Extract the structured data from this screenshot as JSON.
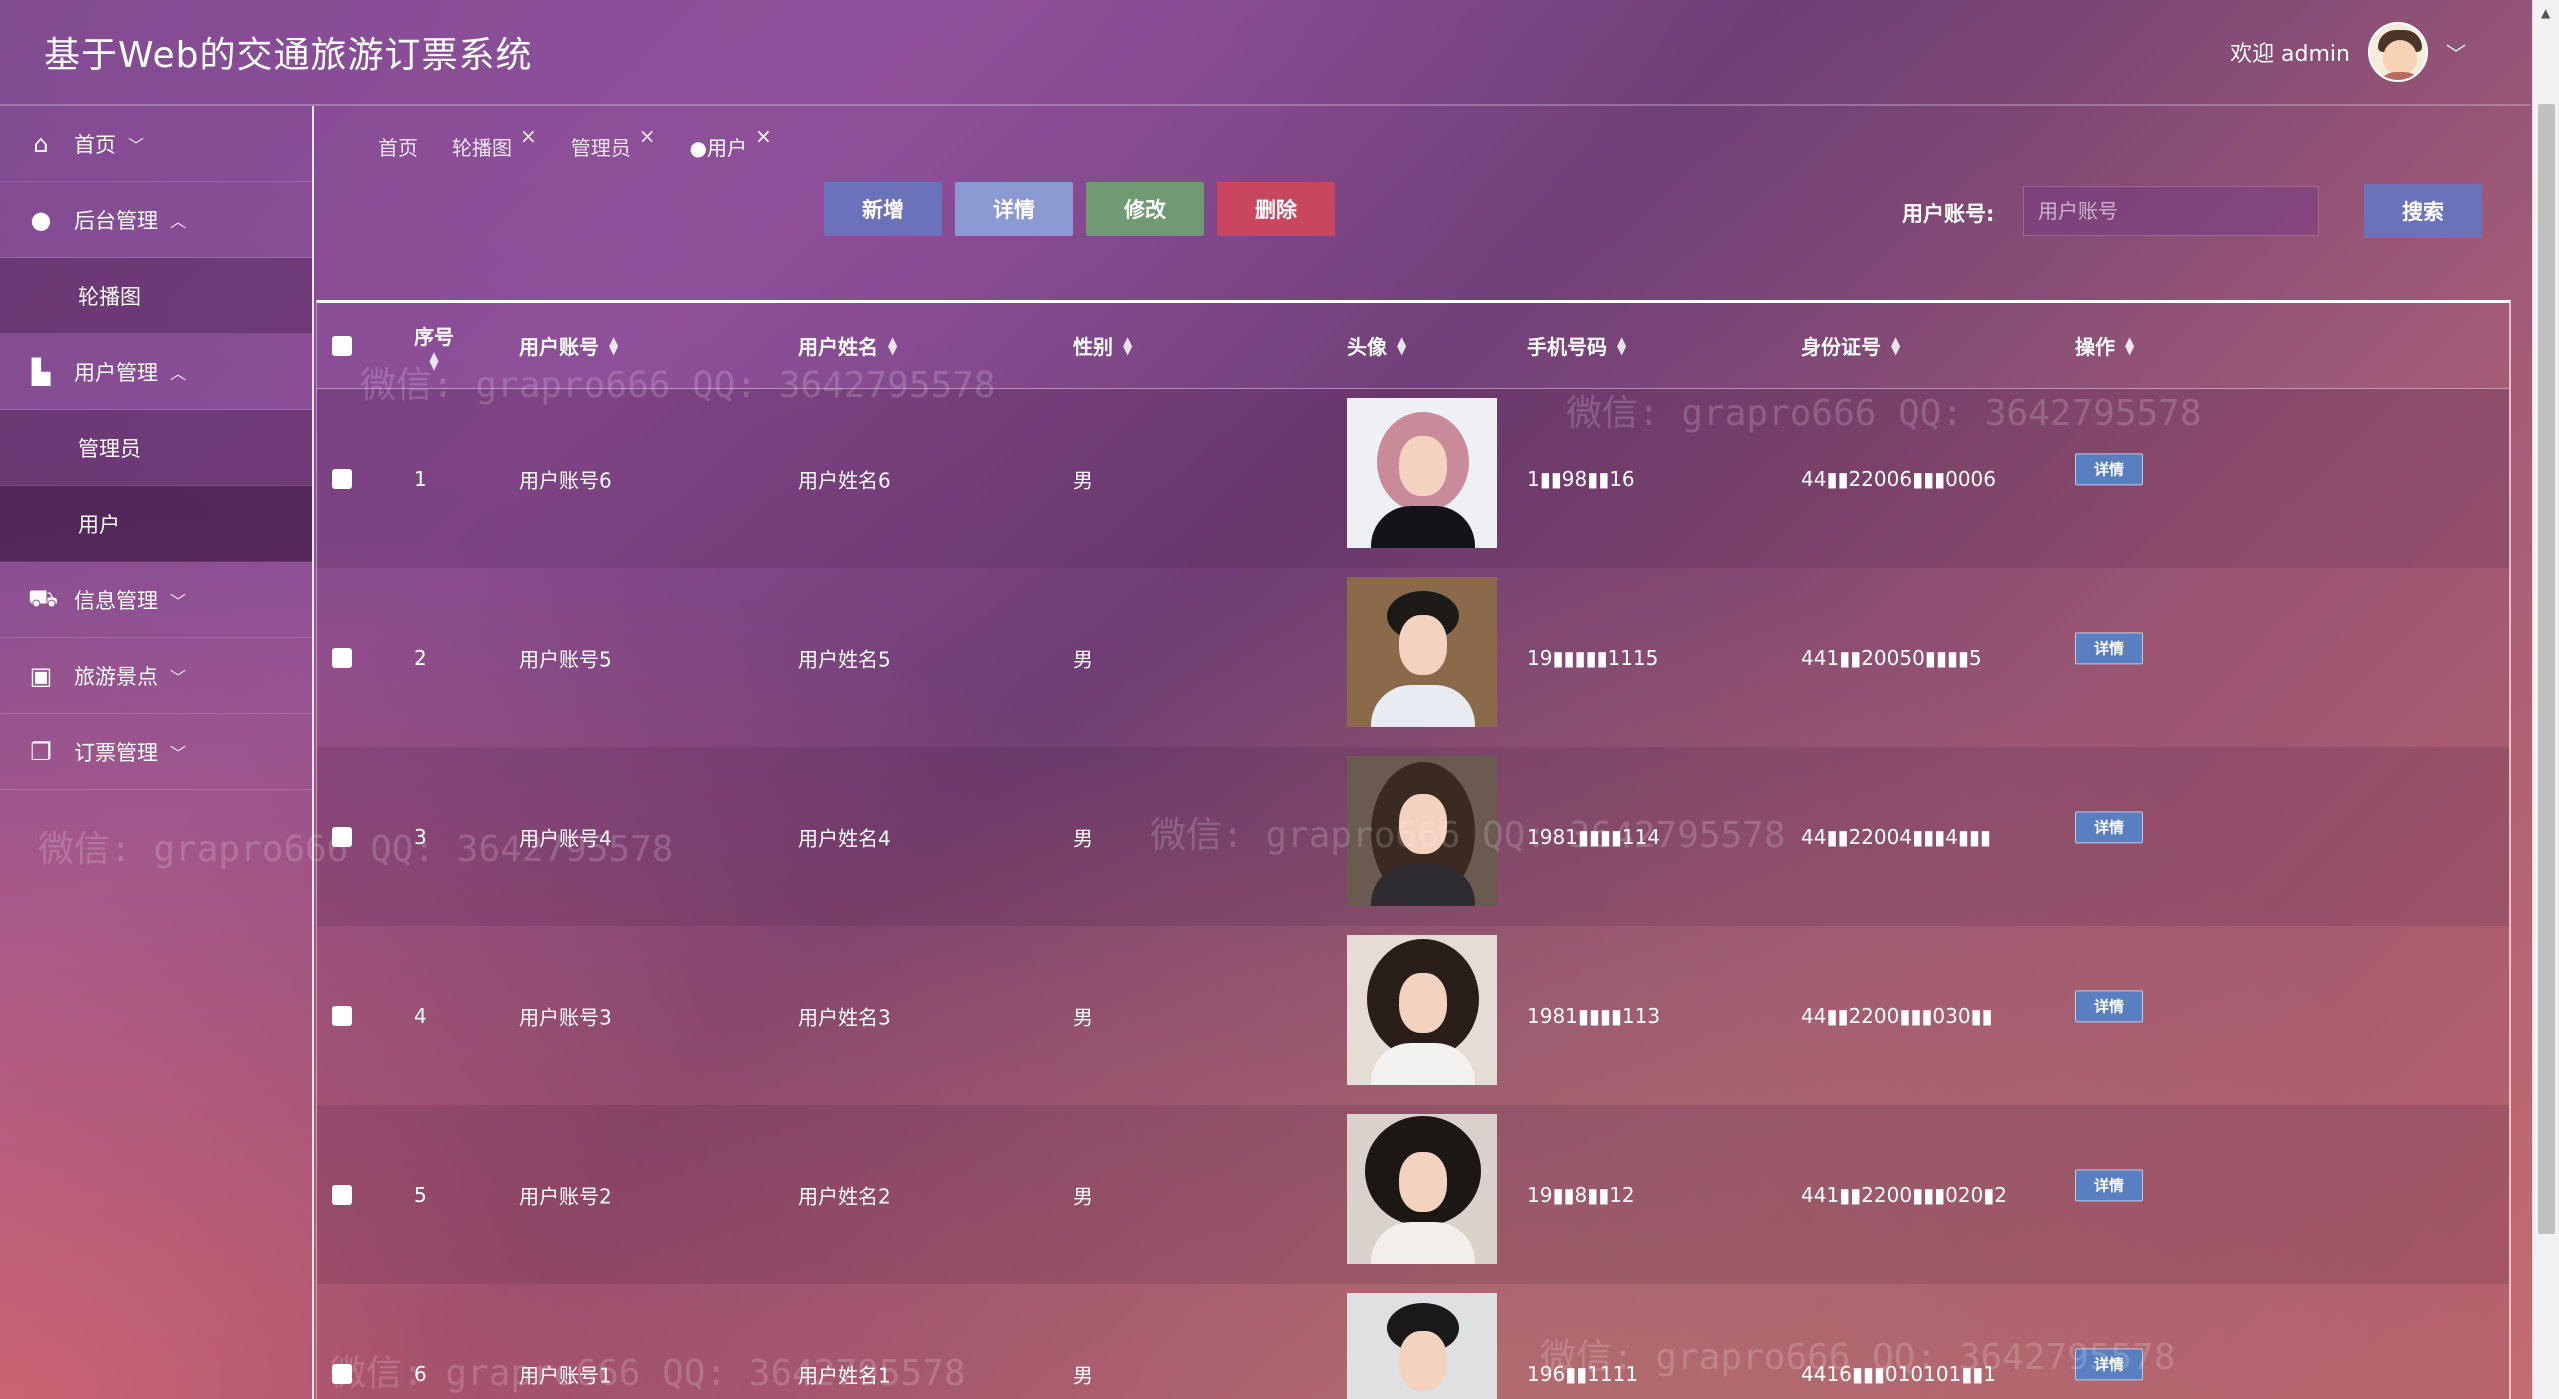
{
  "app": {
    "title": "基于Web的交通旅游订票系统"
  },
  "user": {
    "welcome": "欢迎 admin"
  },
  "sidebar": {
    "items": [
      {
        "label": "首页",
        "icon": "home-icon",
        "caret": "﹀"
      },
      {
        "label": "后台管理",
        "icon": "chat-icon",
        "caret": "︿",
        "children": [
          "轮播图"
        ]
      },
      {
        "label": "用户管理",
        "icon": "user-group-icon",
        "caret": "︿",
        "children": [
          "管理员",
          "用户"
        ]
      },
      {
        "label": "信息管理",
        "icon": "car-icon",
        "caret": "﹀"
      },
      {
        "label": "旅游景点",
        "icon": "chip-icon",
        "caret": "﹀"
      },
      {
        "label": "订票管理",
        "icon": "copy-icon",
        "caret": "﹀"
      }
    ],
    "active_child": "用户"
  },
  "tabs": [
    {
      "label": "首页",
      "closable": false
    },
    {
      "label": "轮播图",
      "closable": true
    },
    {
      "label": "管理员",
      "closable": true
    },
    {
      "label": "●用户",
      "closable": true
    }
  ],
  "toolbar": {
    "add_label": "新增",
    "detail_label": "详情",
    "edit_label": "修改",
    "delete_label": "删除",
    "search_label": "用户账号:",
    "search_placeholder": "用户账号",
    "search_button": "搜索"
  },
  "table": {
    "headers": [
      "序号",
      "用户账号",
      "用户姓名",
      "性别",
      "头像",
      "手机号码",
      "身份证号",
      "操作"
    ],
    "rows": [
      {
        "index": "1",
        "account": "用户账号6",
        "name": "用户姓名6",
        "gender": "男",
        "phone": "1▮▮98▮▮16",
        "idcard": "44▮▮22006▮▮▮0006",
        "action": "详情"
      },
      {
        "index": "2",
        "account": "用户账号5",
        "name": "用户姓名5",
        "gender": "男",
        "phone": "19▮▮▮▮▮1115",
        "idcard": "441▮▮20050▮▮▮▮5",
        "action": "详情"
      },
      {
        "index": "3",
        "account": "用户账号4",
        "name": "用户姓名4",
        "gender": "男",
        "phone": "1981▮▮▮▮114",
        "idcard": "44▮▮22004▮▮▮4▮▮▮",
        "action": "详情"
      },
      {
        "index": "4",
        "account": "用户账号3",
        "name": "用户姓名3",
        "gender": "男",
        "phone": "1981▮▮▮▮113",
        "idcard": "44▮▮2200▮▮▮030▮▮",
        "action": "详情"
      },
      {
        "index": "5",
        "account": "用户账号2",
        "name": "用户姓名2",
        "gender": "男",
        "phone": "19▮▮8▮▮12",
        "idcard": "441▮▮2200▮▮▮020▮2",
        "action": "详情"
      },
      {
        "index": "6",
        "account": "用户账号1",
        "name": "用户姓名1",
        "gender": "男",
        "phone": "196▮▮1111",
        "idcard": "4416▮▮▮010101▮▮1",
        "action": "详情"
      }
    ]
  },
  "watermark": "微信: grapro666 QQ: 3642795578",
  "colors": {
    "add": "#6c72b9",
    "detail": "#8b9ad2",
    "edit": "#6f9a74",
    "delete": "#c9465f",
    "tag": "#5a7fc0"
  }
}
